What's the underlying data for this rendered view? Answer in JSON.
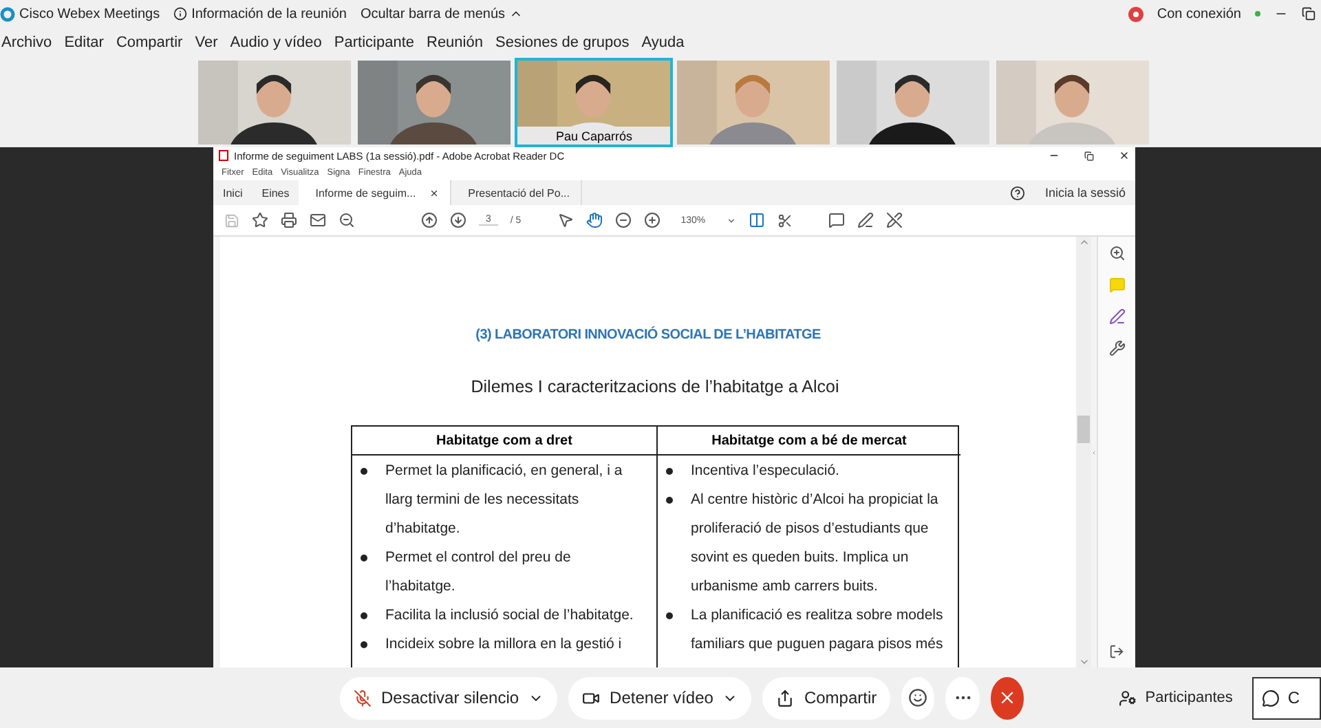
{
  "app": {
    "title": "Cisco Webex Meetings",
    "meeting_info": "Información de la reunión",
    "hide_menu": "Ocultar barra de menús",
    "status": "Con conexión"
  },
  "menu": [
    "Archivo",
    "Editar",
    "Compartir",
    "Ver",
    "Audio y vídeo",
    "Participante",
    "Reunión",
    "Sesiones de grupos",
    "Ayuda"
  ],
  "videos": [
    {
      "selected": false,
      "kind": "picture"
    },
    {
      "selected": false,
      "kind": "picture"
    },
    {
      "selected": true,
      "kind": "picture",
      "name": "Pau Caparrós"
    },
    {
      "selected": false,
      "kind": "picture"
    },
    {
      "selected": false,
      "kind": "picture"
    },
    {
      "selected": false,
      "kind": "picture"
    }
  ],
  "acrobat": {
    "title": "Informe de seguiment LABS (1a sessió).pdf - Adobe Acrobat Reader DC",
    "menu": [
      "Fitxer",
      "Edita",
      "Visualitza",
      "Signa",
      "Finestra",
      "Ajuda"
    ],
    "nav": [
      "Inici",
      "Eines"
    ],
    "tabs": [
      {
        "label": "Informe de seguim...",
        "selected": true,
        "closable": true
      },
      {
        "label": "Presentació del Po...",
        "selected": false,
        "closable": false
      }
    ],
    "sign_in": "Inicia la sessió",
    "page": "3",
    "pages": "/ 5",
    "zoom": "130%"
  },
  "document": {
    "heading": "(3) LABORATORI INNOVACIÓ SOCIAL DE L’HABITATGE",
    "subtitle": "Dilemes I caracteritzacions  de l’habitatge a Alcoi",
    "columns": [
      "Habitatge com a dret",
      "Habitatge com a bé de mercat"
    ],
    "cells": [
      [
        {
          "lines": [
            "Permet la planificació, en general, i a",
            "llarg termini de les necessitats",
            "d’habitatge."
          ]
        },
        {
          "lines": [
            "Permet el control del preu de",
            "l’habitatge."
          ]
        },
        {
          "lines": [
            "Facilita la inclusió social de l’habitatge."
          ]
        },
        {
          "lines": [
            "Incideix sobre la millora  en la gestió i"
          ]
        }
      ],
      [
        {
          "lines": [
            "Incentiva l’especulació."
          ]
        },
        {
          "lines": [
            "Al centre històric d’Alcoi ha propiciat la",
            "proliferació de pisos d’estudiants que",
            "sovint es queden buits.  Implica un",
            "urbanisme amb carrers buits."
          ]
        },
        {
          "lines": [
            "La planificació es realitza sobre models",
            "familiars que puguen pagara pisos més"
          ]
        }
      ]
    ]
  },
  "controls": {
    "mute": "Desactivar silencio",
    "video": "Detener vídeo",
    "share": "Compartir",
    "participants": "Participantes",
    "chat": "C"
  }
}
